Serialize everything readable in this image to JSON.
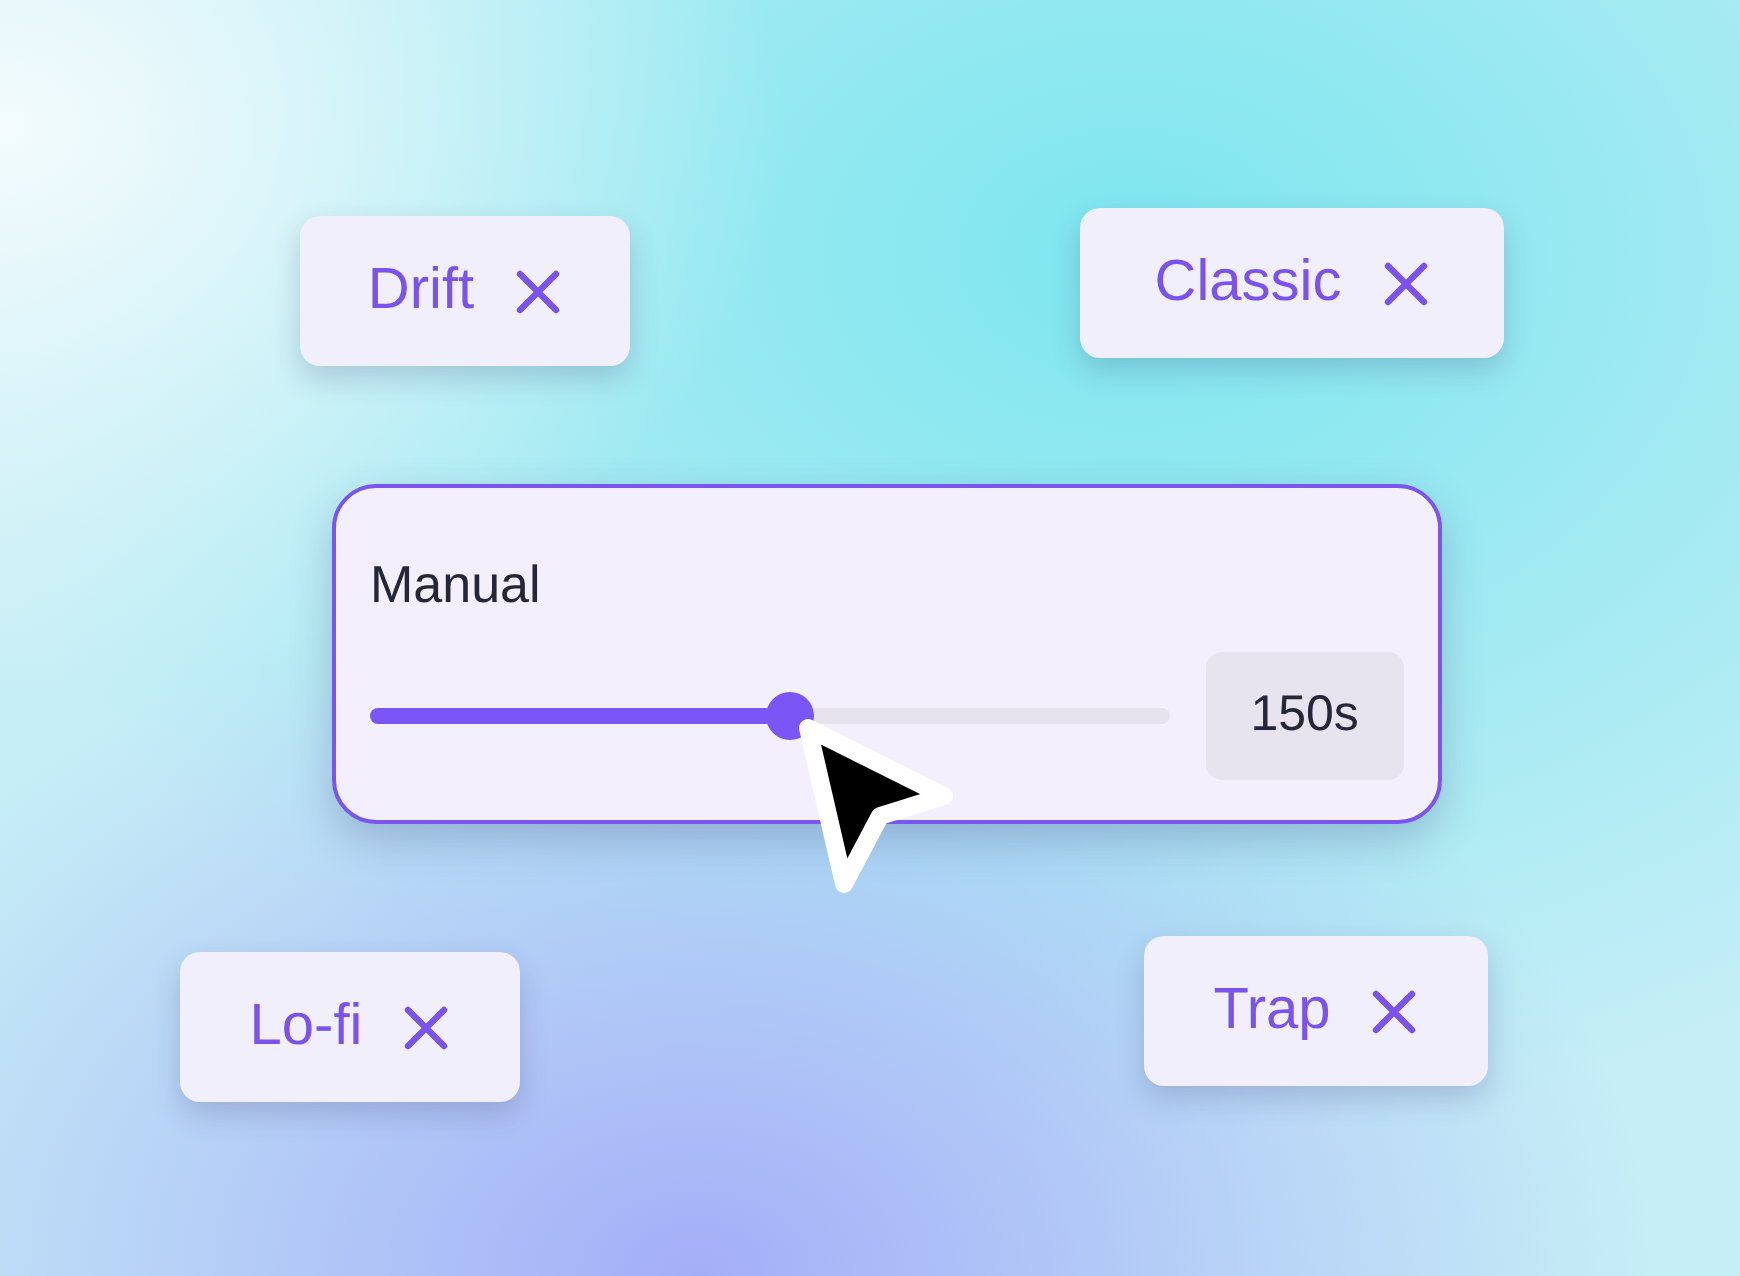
{
  "tags": [
    {
      "label": "Drift"
    },
    {
      "label": "Classic"
    },
    {
      "label": "Lo-fi"
    },
    {
      "label": "Trap"
    }
  ],
  "card": {
    "title": "Manual",
    "slider": {
      "level": 0.525
    },
    "value": "150s"
  }
}
